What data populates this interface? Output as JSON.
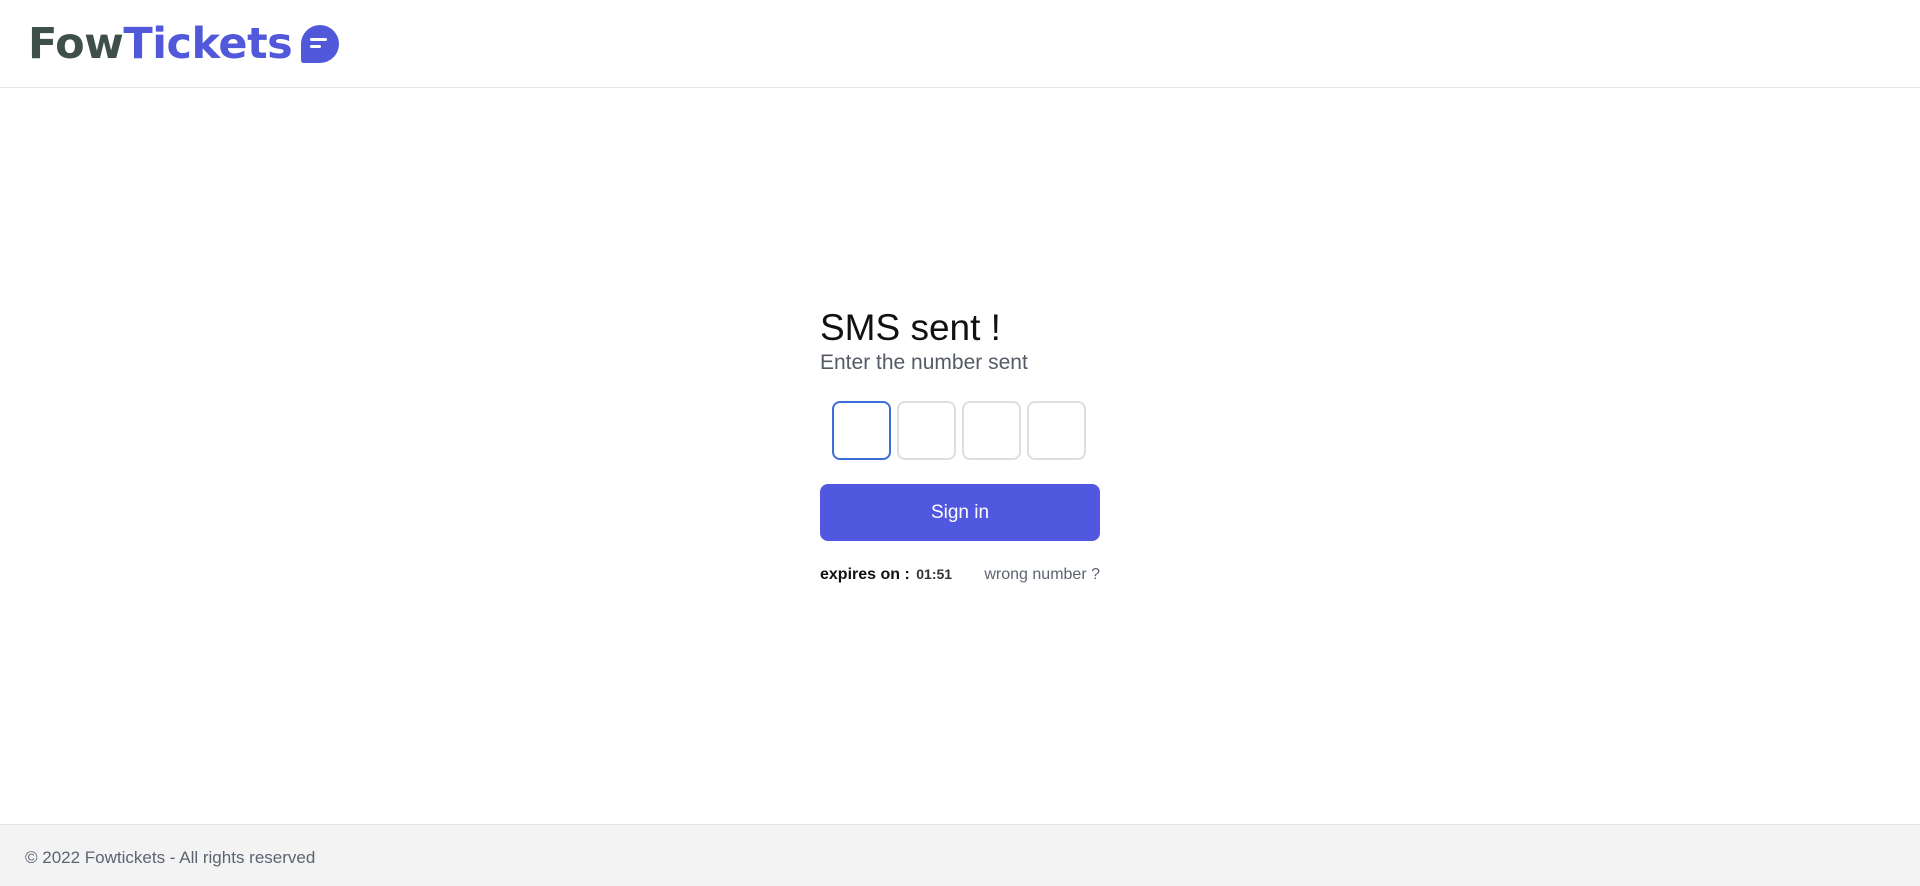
{
  "header": {
    "logo": {
      "part1": "Fow",
      "part2": "Tickets",
      "icon": "chat-bubble-icon",
      "color_part1": "#3f4f4c",
      "color_part2": "#5158d9"
    }
  },
  "main": {
    "title": "SMS sent !",
    "subtitle": "Enter the number sent",
    "code_inputs": [
      {
        "value": "",
        "focused": true
      },
      {
        "value": "",
        "focused": false
      },
      {
        "value": "",
        "focused": false
      },
      {
        "value": "",
        "focused": false
      }
    ],
    "signin_label": "Sign in",
    "expires_label": "expires on :",
    "expires_time": "01:51",
    "wrong_number_label": "wrong number ?"
  },
  "footer": {
    "text": "© 2022 Fowtickets - All rights reserved"
  },
  "colors": {
    "accent": "#5158e0",
    "focus_border": "#3b6fd8",
    "footer_bg": "#f3f3f4"
  }
}
